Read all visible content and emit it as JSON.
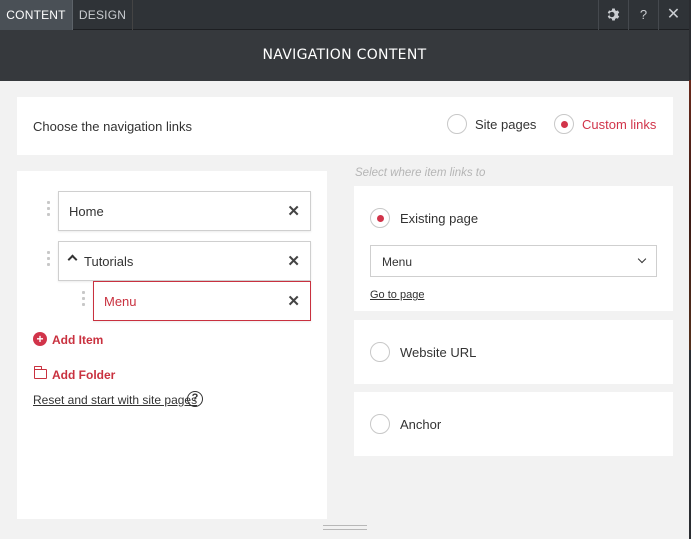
{
  "tabs": {
    "content": "CONTENT",
    "design": "DESIGN"
  },
  "toolbar": {
    "help": "?",
    "close": "✕"
  },
  "header": {
    "title": "NAVIGATION CONTENT"
  },
  "choose": {
    "label": "Choose the navigation links",
    "options": [
      {
        "label": "Site pages",
        "selected": false
      },
      {
        "label": "Custom links",
        "selected": true
      }
    ]
  },
  "nav_items": [
    {
      "label": "Home",
      "remove": "✕"
    },
    {
      "label": "Tutorials",
      "remove": "✕"
    },
    {
      "label": "Menu",
      "remove": "✕"
    }
  ],
  "actions": {
    "add_item": "Add Item",
    "add_folder": "Add Folder",
    "reset": "Reset and start with site pages",
    "help": "?"
  },
  "link_target": {
    "hint": "Select where item links to",
    "existing_page": {
      "label": "Existing page",
      "selected": true,
      "select_value": "Menu",
      "goto": "Go to page"
    },
    "website_url": {
      "label": "Website URL",
      "selected": false
    },
    "anchor": {
      "label": "Anchor",
      "selected": false
    }
  },
  "colors": {
    "accent": "#d1344a",
    "header_bg": "#36393d",
    "tabbar_bg": "#2f3337"
  }
}
